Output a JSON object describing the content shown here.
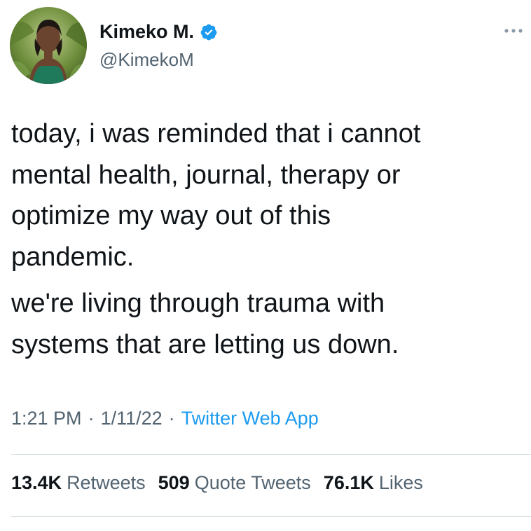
{
  "author": {
    "display_name": "Kimeko M.",
    "handle": "@KimekoM",
    "verified": true,
    "avatar_icon": "user-avatar-photo"
  },
  "tweet": {
    "paragraphs": [
      "today, i was reminded that i cannot\nmental health, journal, therapy or\noptimize my way out of this\npandemic.",
      "we're living through trauma with\nsystems that are letting us down."
    ]
  },
  "meta": {
    "time": "1:21 PM",
    "date": "1/11/22",
    "separator": "·",
    "source": "Twitter Web App"
  },
  "stats": {
    "retweets": {
      "count": "13.4K",
      "label": "Retweets"
    },
    "quote_tweets": {
      "count": "509",
      "label": "Quote Tweets"
    },
    "likes": {
      "count": "76.1K",
      "label": "Likes"
    }
  },
  "colors": {
    "text_primary": "#0f1419",
    "text_secondary": "#536471",
    "accent": "#1d9bf0",
    "divider": "#cfd9de"
  },
  "icons": {
    "verified": "verified-badge-icon",
    "more": "more-options-icon"
  }
}
